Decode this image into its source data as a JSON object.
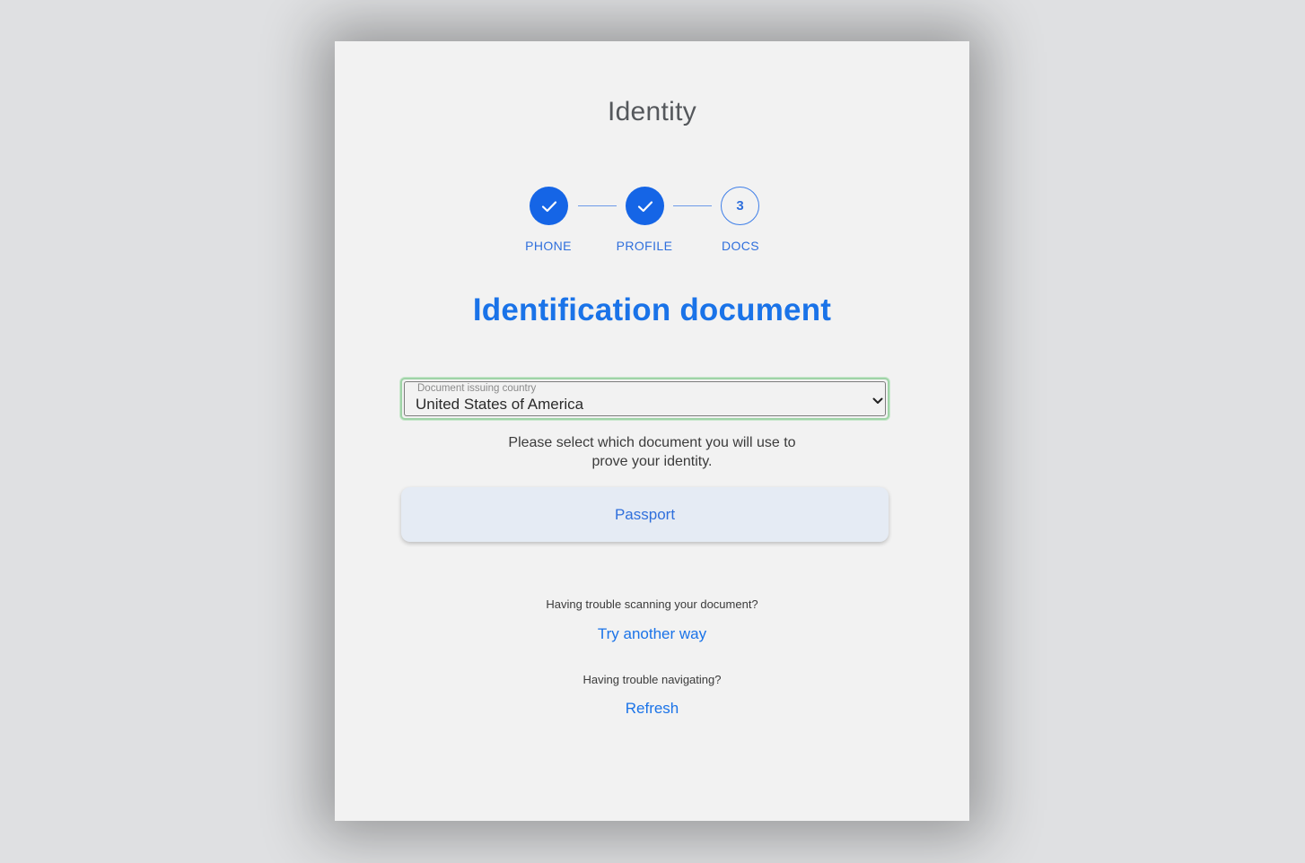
{
  "app": {
    "title": "Identity"
  },
  "stepper": {
    "steps": [
      {
        "label": "PHONE",
        "state": "complete",
        "icon": "check-icon"
      },
      {
        "label": "PROFILE",
        "state": "complete",
        "icon": "check-icon"
      },
      {
        "label": "DOCS",
        "state": "current",
        "number": "3"
      }
    ]
  },
  "section": {
    "title": "Identification document"
  },
  "country_select": {
    "label": "Document issuing country",
    "value": "United States of America",
    "icon": "chevron-down-icon"
  },
  "instruction": {
    "line1": "Please select which document you will use to",
    "line2": "prove your identity."
  },
  "documents": {
    "passport_label": "Passport"
  },
  "help": {
    "scanning_question": "Having trouble scanning your document?",
    "scanning_link": "Try another way",
    "navigating_question": "Having trouble navigating?",
    "navigating_link": "Refresh"
  },
  "colors": {
    "accent": "#1a73e8",
    "step_complete": "#1565e6",
    "background": "#dfe0e2",
    "card": "#f2f2f2"
  }
}
